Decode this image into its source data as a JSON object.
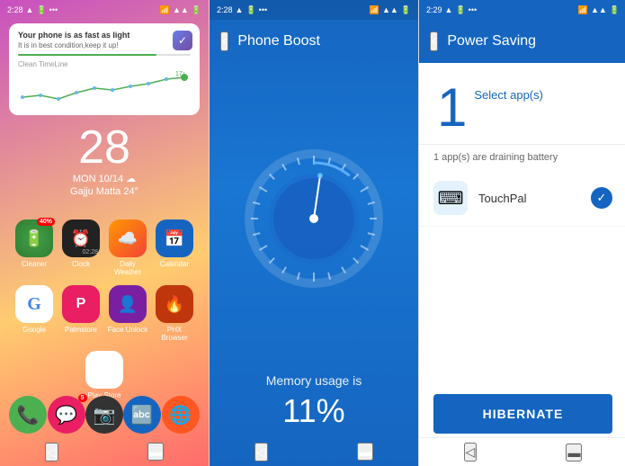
{
  "panel_home": {
    "status_time": "2:28",
    "notification": {
      "title": "Your phone is as fast as light",
      "body": "It is in best condition,keep it up!",
      "brand": "Clean TimeLine"
    },
    "date_number": "28",
    "day_info": "MON 10/14",
    "location": "Gajju Matta 24°",
    "apps_row1": [
      {
        "label": "Cleaner",
        "color": "#4CAF50",
        "icon": "🔋",
        "badge": "40%"
      },
      {
        "label": "Clock",
        "color": "#333",
        "icon": "⏰",
        "badge": ""
      },
      {
        "label": "Daily Weather",
        "color": "#FF9800",
        "icon": "☁️",
        "badge": ""
      },
      {
        "label": "Calendar",
        "color": "#1565C0",
        "icon": "📅",
        "badge": ""
      }
    ],
    "apps_row2": [
      {
        "label": "Google",
        "color": "#4285F4",
        "icon": "G",
        "badge": ""
      },
      {
        "label": "Palmstore",
        "color": "#E91E63",
        "icon": "P",
        "badge": ""
      },
      {
        "label": "Face Unlock",
        "color": "#9C27B0",
        "icon": "👤",
        "badge": ""
      },
      {
        "label": "PHX Browser",
        "color": "#FF5722",
        "icon": "🔥",
        "badge": ""
      },
      {
        "label": "Play Store",
        "color": "#4CAF50",
        "icon": "▶",
        "badge": ""
      }
    ],
    "dock": [
      {
        "icon": "📞",
        "color": "#4CAF50",
        "label": "phone",
        "badge": ""
      },
      {
        "icon": "💬",
        "color": "#E91E63",
        "label": "messages",
        "badge": "5"
      },
      {
        "icon": "📷",
        "color": "#333",
        "label": "camera",
        "badge": ""
      },
      {
        "icon": "🔤",
        "color": "#1565C0",
        "label": "translate",
        "badge": ""
      },
      {
        "icon": "🌐",
        "color": "#FF5722",
        "label": "chrome",
        "badge": ""
      }
    ]
  },
  "panel_boost": {
    "status_time": "2:28",
    "back_icon": "‹",
    "title": "Phone Boost",
    "memory_label": "Memory usage is",
    "memory_value": "11%",
    "speedometer_progress": 11
  },
  "panel_power": {
    "status_time": "2:29",
    "back_icon": "‹",
    "title": "Power Saving",
    "select_number": "1",
    "select_label": "Select app(s)",
    "draining_text": "1 app(s) are draining battery",
    "app": {
      "name": "TouchPal",
      "icon": "⌨"
    },
    "hibernate_label": "HIBERNATE"
  }
}
